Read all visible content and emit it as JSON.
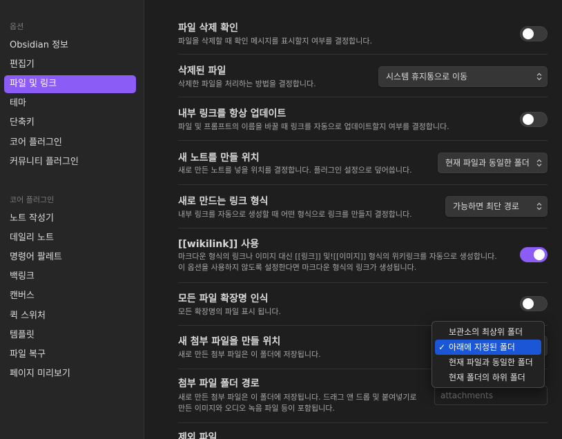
{
  "sidebar": {
    "section_options": "옵션",
    "options": [
      {
        "label": "Obsidian 정보"
      },
      {
        "label": "편집기"
      },
      {
        "label": "파일 및 링크",
        "active": true
      },
      {
        "label": "테마"
      },
      {
        "label": "단축키"
      },
      {
        "label": "코어 플러그인"
      },
      {
        "label": "커뮤니티 플러그인"
      }
    ],
    "section_core": "코어 플러그인",
    "core": [
      {
        "label": "노트 작성기"
      },
      {
        "label": "데일리 노트"
      },
      {
        "label": "명령어 팔레트"
      },
      {
        "label": "백링크"
      },
      {
        "label": "캔버스"
      },
      {
        "label": "퀵 스위처"
      },
      {
        "label": "템플릿"
      },
      {
        "label": "파일 복구"
      },
      {
        "label": "페이지 미리보기"
      }
    ]
  },
  "settings": {
    "confirm_delete": {
      "name": "파일 삭제 확인",
      "desc": "파일을 삭제할 때 확인 메시지를 표시할지 여부를 결정합니다.",
      "enabled": false
    },
    "deleted_files": {
      "name": "삭제된 파일",
      "desc": "삭제한 파일을 처리하는 방법을 결정합니다.",
      "value": "시스템 휴지통으로 이동"
    },
    "update_links": {
      "name": "내부 링크를 항상 업데이트",
      "desc": "파일 및 프롬프트의 이름을 바꿀 때 링크를 자동으로 업데이트할지 여부를 결정합니다.",
      "enabled": false
    },
    "new_note_location": {
      "name": "새 노트를 만들 위치",
      "desc": "새로 만든 노트를 넣을 위치를 결정합니다. 플러그인 설정으로 덮어씁니다.",
      "value": "현재 파일과 동일한 폴더"
    },
    "link_format": {
      "name": "새로 만드는 링크 형식",
      "desc": "내부 링크를 자동으로 생성할 때 어떤 형식으로 링크를 만들지 결정합니다.",
      "value": "가능하면 최단 경로"
    },
    "wikilink": {
      "name": "[[wikilink]] 사용",
      "desc1": "마크다운 형식의 링크나 이미지 대신 [[링크]] 및![[이미지]] 형식의 위키링크를 자동으로 생성합니다.",
      "desc2": "이 옵션을 사용하지 않도록 설정한다면 마크다운 형식의 링크가 생성됩니다.",
      "enabled": true
    },
    "all_extensions": {
      "name": "모든 파일 확장명 인식",
      "desc": "모든 확장명의 파일 표시 됩니다.",
      "enabled": false
    },
    "attachment_location": {
      "name": "새 첨부 파일을 만들 위치",
      "desc": "새로 만든 첨부 파일은 이 폴더에 저장됩니다."
    },
    "attachment_path": {
      "name": "첨부 파일 폴더 경로",
      "desc1": "새로 만든 첨부 파일은 이 폴더에 저장됩니다. 드래그 앤 드롭 및 붙여넣기로",
      "desc2": "만든 이미지와 오디오 녹음 파일 등이 포함됩니다.",
      "placeholder": "attachments"
    },
    "excluded_files": {
      "name": "제외 파일"
    }
  },
  "popup": {
    "items": [
      {
        "label": "보관소의 최상위 폴더"
      },
      {
        "label": "아래에 지정된 폴더",
        "selected": true,
        "check": "✓"
      },
      {
        "label": "현재 파일과 동일한 폴더"
      },
      {
        "label": "현재 폴더의 하위 폴더"
      }
    ]
  },
  "colors": {
    "accent": "#8b5cf6",
    "selection": "#1a56d6",
    "background": "#1e1e1e",
    "sidebar": "#262626"
  }
}
